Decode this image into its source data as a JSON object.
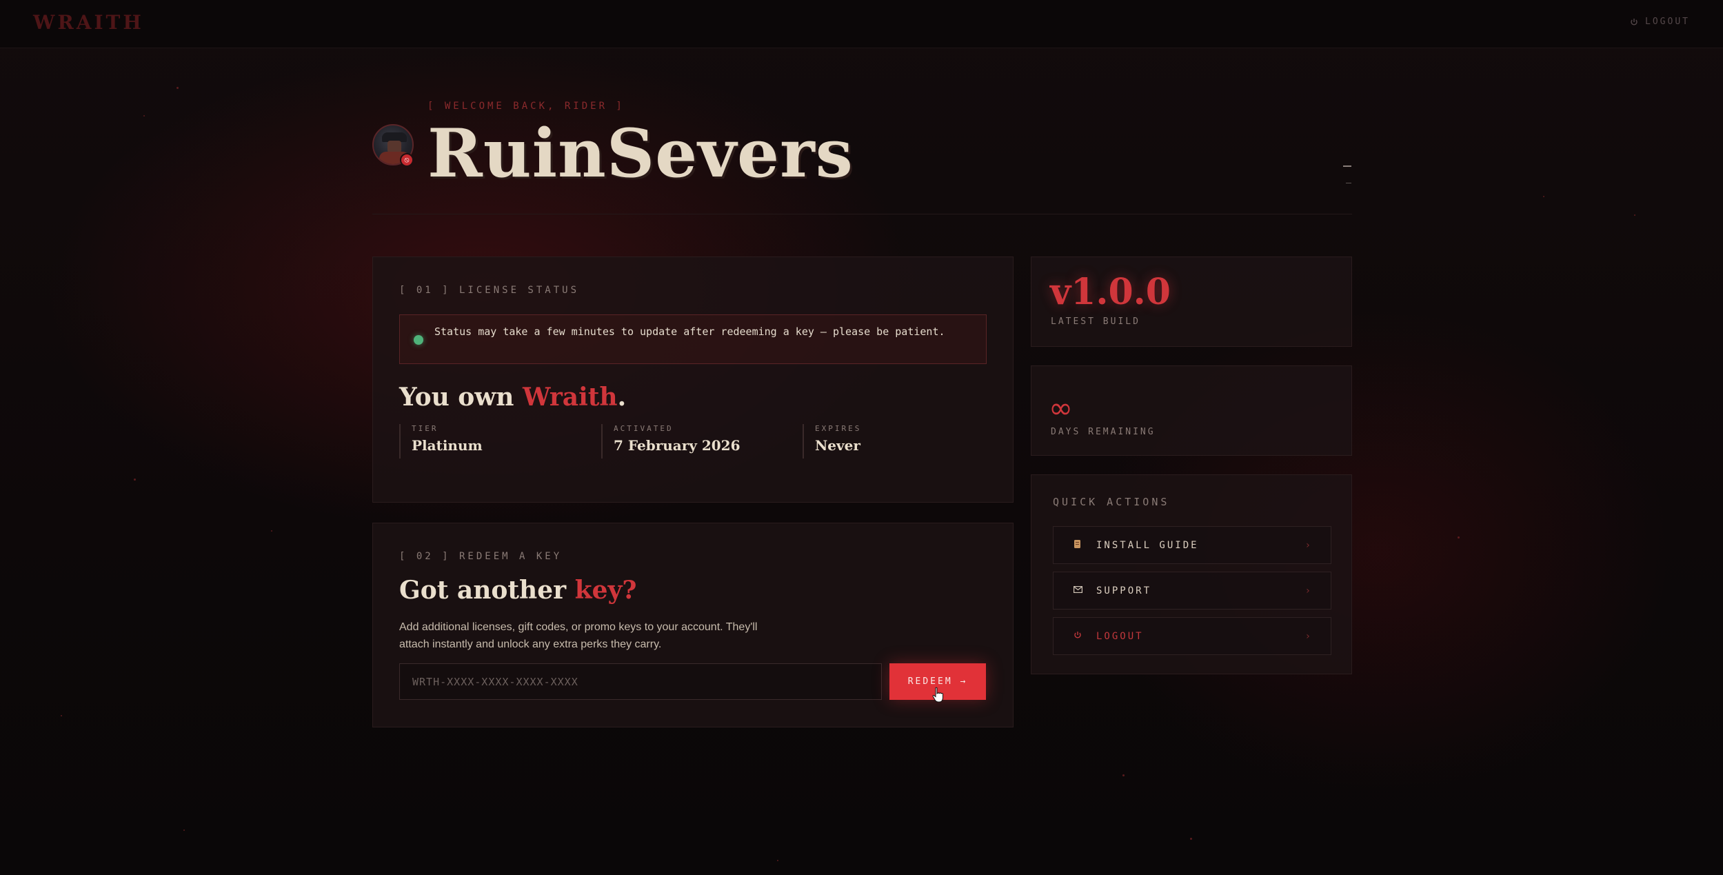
{
  "topbar": {
    "brand": "WRAITH",
    "logout_label": "LOGOUT"
  },
  "header": {
    "welcome": "[ WELCOME BACK, RIDER ]",
    "username": "RuinSevers"
  },
  "license": {
    "section_label": "[ 01 ] LICENSE STATUS",
    "notice": "Status may take a few minutes to update after redeeming a key — please be patient.",
    "title_prefix": "You own",
    "title_product": "Wraith",
    "title_suffix": ".",
    "stats": [
      {
        "label": "TIER",
        "value": "Platinum"
      },
      {
        "label": "ACTIVATED",
        "value": "7 February 2026"
      },
      {
        "label": "EXPIRES",
        "value": "Never"
      }
    ]
  },
  "redeem": {
    "section_label": "[ 02 ] REDEEM A KEY",
    "title_prefix": "Got another",
    "title_accent": "key?",
    "description": "Add additional licenses, gift codes, or promo keys to your account. They'll attach instantly and unlock any extra perks they carry.",
    "input_value": "",
    "input_placeholder": "WRTH-XXXX-XXXX-XXXX-XXXX",
    "button_label": "REDEEM →"
  },
  "version": {
    "number": "v1.0.0",
    "label": "LATEST BUILD"
  },
  "days": {
    "value": "∞",
    "label": "DAYS REMAINING"
  },
  "quick_actions": {
    "title": "QUICK ACTIONS",
    "items": [
      {
        "label": "INSTALL GUIDE",
        "icon": "scroll-icon"
      },
      {
        "label": "SUPPORT",
        "icon": "envelope-icon"
      },
      {
        "label": "LOGOUT",
        "icon": "power-icon"
      }
    ]
  },
  "colors": {
    "accent": "#d0363b",
    "button": "#e13238",
    "status_ok": "#4fb37a",
    "background": "#0c0809"
  }
}
